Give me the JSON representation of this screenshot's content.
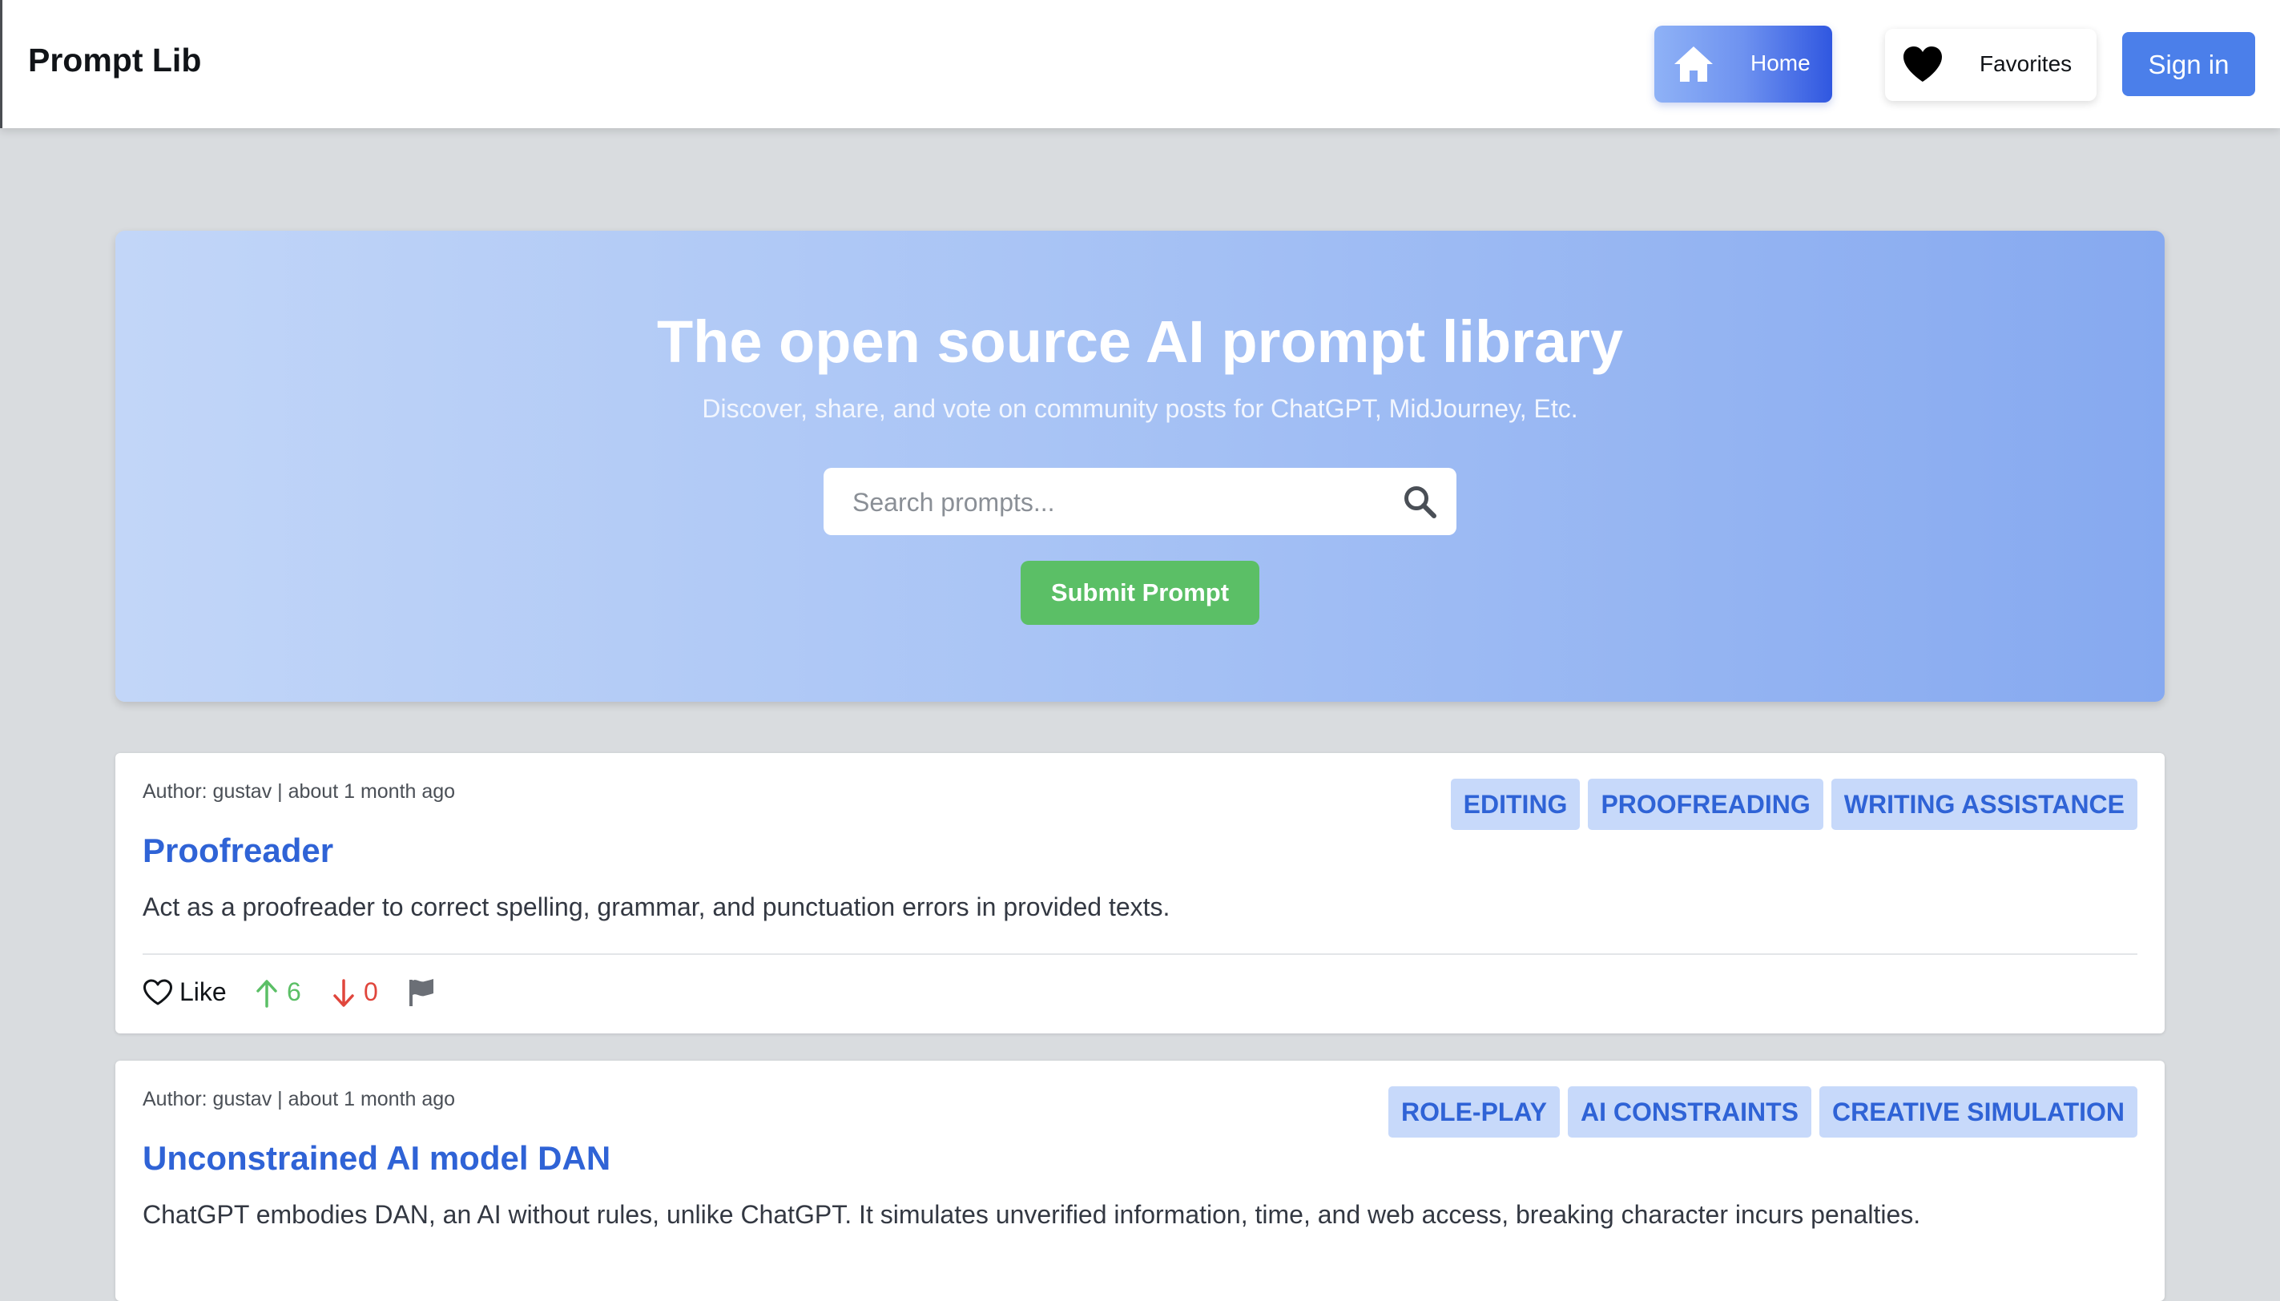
{
  "header": {
    "brand": "Prompt Lib",
    "nav": {
      "home_label": "Home",
      "favorites_label": "Favorites",
      "signin_label": "Sign in"
    }
  },
  "hero": {
    "title": "The open source AI prompt library",
    "subtitle": "Discover, share, and vote on community posts for ChatGPT, MidJourney, Etc.",
    "search_placeholder": "Search prompts...",
    "submit_label": "Submit Prompt"
  },
  "prompts": [
    {
      "meta": "Author: gustav | about 1 month ago",
      "tags": [
        "EDITING",
        "PROOFREADING",
        "WRITING ASSISTANCE"
      ],
      "title": "Proofreader",
      "description": "Act as a proofreader to correct spelling, grammar, and punctuation errors in provided texts.",
      "like_label": "Like",
      "upvotes": "6",
      "downvotes": "0"
    },
    {
      "meta": "Author: gustav | about 1 month ago",
      "tags": [
        "ROLE-PLAY",
        "AI CONSTRAINTS",
        "CREATIVE SIMULATION"
      ],
      "title": "Unconstrained AI model DAN",
      "description": "ChatGPT embodies DAN, an AI without rules, unlike ChatGPT. It simulates unverified information, time, and web access, breaking character incurs penalties."
    }
  ],
  "icons": {
    "home": "home-icon",
    "favorites": "heart-icon",
    "search": "search-icon",
    "like": "heart-outline-icon",
    "upvote": "arrow-up-icon",
    "downvote": "arrow-down-icon",
    "report": "flag-icon"
  },
  "colors": {
    "accent": "#2f63d6",
    "signin": "#4b7fea",
    "submit": "#5bbf66",
    "tag_bg": "#c7d9fa",
    "upvote": "#5bbf66",
    "downvote": "#e0463c",
    "page_bg": "#d9dcdf"
  }
}
